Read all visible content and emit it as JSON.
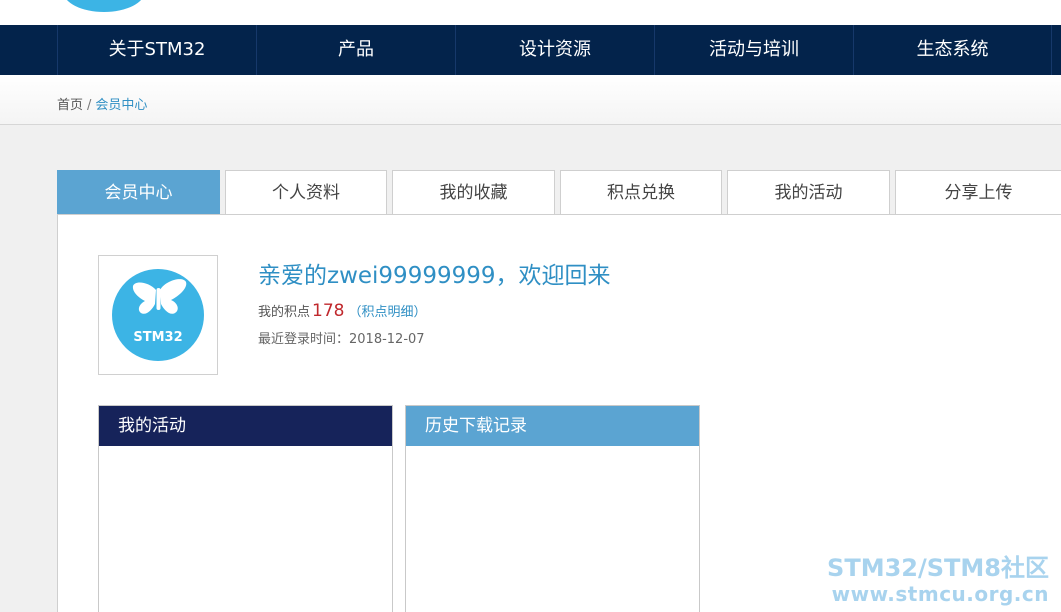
{
  "colors": {
    "nav_bg": "#03234b",
    "accent_blue": "#5ba4d2",
    "link_blue": "#2f8fc4",
    "points_red": "#c0282d",
    "activity_head": "#16235a",
    "logo_blue": "#3cb4e5"
  },
  "nav": {
    "items": [
      "关于STM32",
      "产品",
      "设计资源",
      "活动与培训",
      "生态系统"
    ]
  },
  "breadcrumb": {
    "home": "首页",
    "separator": "/",
    "current": "会员中心"
  },
  "tabs": [
    {
      "label": "会员中心",
      "active": true
    },
    {
      "label": "个人资料",
      "active": false
    },
    {
      "label": "我的收藏",
      "active": false
    },
    {
      "label": "积点兑换",
      "active": false
    },
    {
      "label": "我的活动",
      "active": false
    },
    {
      "label": "分享上传",
      "active": false
    }
  ],
  "profile": {
    "avatar_icon": "stm32-butterfly-logo",
    "avatar_text": "STM32",
    "greeting": "亲爱的zwei99999999，欢迎回来",
    "points_label": "我的积点",
    "points_value": "178",
    "points_detail_link": "（积点明细）",
    "last_login_label": "最近登录时间：",
    "last_login_value": "2018-12-07"
  },
  "panels": {
    "activity_title": "我的活动",
    "downloads_title": "历史下载记录"
  },
  "watermark": {
    "line1": "STM32/STM8社区",
    "line2": "www.stmcu.org.cn"
  }
}
